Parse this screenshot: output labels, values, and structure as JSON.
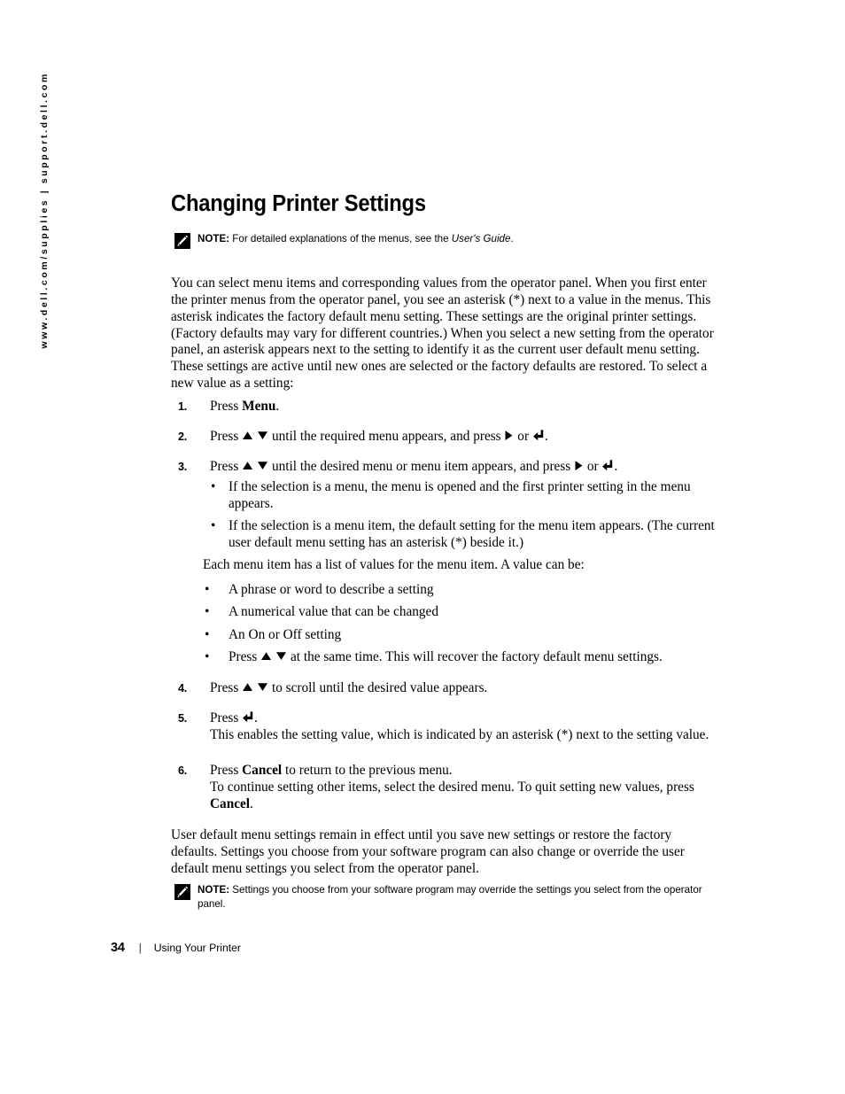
{
  "sidebar": {
    "url_text": "www.dell.com/supplies | support.dell.com"
  },
  "page": {
    "heading": "Changing Printer Settings"
  },
  "notes": {
    "top": {
      "label": "NOTE:",
      "text_before": " For detailed explanations of the menus, see the ",
      "italic": "User's Guide",
      "text_after": "."
    },
    "bottom": {
      "label": "NOTE:",
      "text": " Settings you choose from your software program may override the settings you select from the operator panel."
    }
  },
  "paragraphs": {
    "intro": "You can select menu items and corresponding values from the operator panel. When you first enter the printer menus from the operator panel, you see an asterisk (*) next to a value in the menus. This asterisk indicates the factory default menu setting. These settings are the original printer settings. (Factory defaults may vary for different countries.) When you select a new setting from the operator panel, an asterisk appears next to the setting to identify it as the current user default menu setting. These settings are active until new ones are selected or the factory defaults are restored. To select a new value as a setting:",
    "each_menu_item": "Each menu item has a list of values for the menu item. A value can be:",
    "tail": "User default menu settings remain in effect until you save new settings or restore the factory defaults. Settings you choose from your software program can also change or override the user default menu settings you select from the operator panel."
  },
  "steps": {
    "step1": {
      "number": "1.",
      "pre": "Press ",
      "bold": "Menu",
      "post": "."
    },
    "step2": {
      "number": "2.",
      "seg1": "Press ",
      "seg2": " until the required menu appears, and press ",
      "seg3": " or ",
      "seg4": "."
    },
    "step3": {
      "number": "3.",
      "seg1": "Press ",
      "seg2": " until the desired menu or menu item appears, and press ",
      "seg3": " or ",
      "seg4": "."
    },
    "step4": {
      "number": "4.",
      "seg1": "Press ",
      "seg2": " to scroll until the desired value appears."
    },
    "step5": {
      "number": "5.",
      "seg1": "Press ",
      "seg2": ".",
      "continuation": "This enables the setting value, which is indicated by an asterisk (*) next to the setting value."
    },
    "step6": {
      "number": "6.",
      "pre": "Press ",
      "bold": "Cancel",
      "post": " to return to the previous menu.",
      "cont_pre": "To continue setting other items, select the desired menu. To quit setting new values, press ",
      "cont_bold": "Cancel",
      "cont_post": "."
    }
  },
  "bullets_selection": [
    "If the selection is a menu, the menu is opened and the first printer setting in the menu appears.",
    "If the selection is a menu item, the default setting for the menu item appears. (The current user default menu setting has an asterisk (*) beside it.)"
  ],
  "bullets_values": {
    "item1": "A phrase or word to describe a setting",
    "item2": "A numerical value that can be changed",
    "item3": "An On or Off setting",
    "item4_seg1": "Press ",
    "item4_seg2": " at the same time. This will recover the factory default menu settings."
  },
  "bullet_char": "•",
  "footer": {
    "page_number": "34",
    "separator": "|",
    "label": "Using Your Printer"
  },
  "colors": {
    "text": "#000000",
    "background": "#ffffff"
  }
}
